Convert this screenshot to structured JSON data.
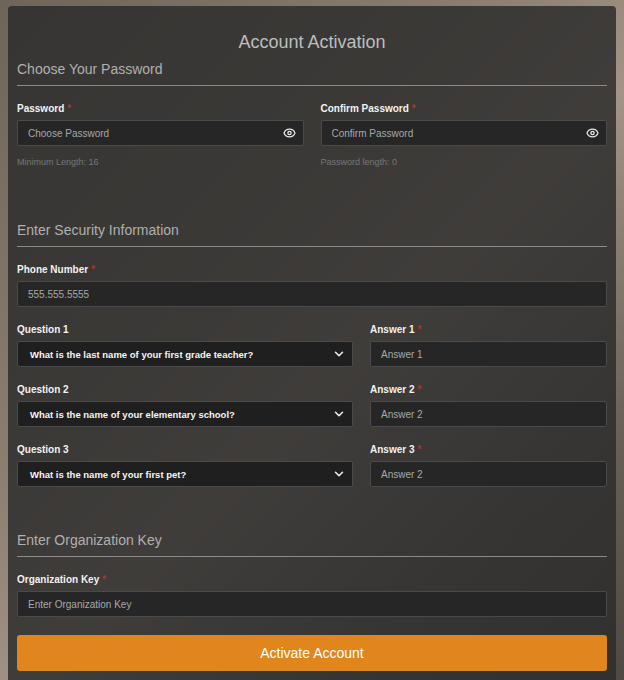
{
  "title": "Account Activation",
  "required_mark": "*",
  "password_section": {
    "heading": "Choose Your Password",
    "fields": [
      {
        "label": "Password",
        "placeholder": "Choose Password",
        "hint": "Minimum Length: 16",
        "required": true
      },
      {
        "label": "Confirm Password",
        "placeholder": "Confirm Password",
        "hint": "Password length: 0",
        "required": true
      }
    ]
  },
  "security_section": {
    "heading": "Enter Security Information",
    "phone": {
      "label": "Phone Number",
      "placeholder": "555.555.5555",
      "required": true
    },
    "questions": [
      {
        "label": "Question 1",
        "value": "What is the last name of your first grade teacher?",
        "answer_label": "Answer 1",
        "answer_placeholder": "Answer 1",
        "required": true
      },
      {
        "label": "Question 2",
        "value": "What is the name of your elementary school?",
        "answer_label": "Answer 2",
        "answer_placeholder": "Answer 2",
        "required": true
      },
      {
        "label": "Question 3",
        "value": "What is the name of your first pet?",
        "answer_label": "Answer 3",
        "answer_placeholder": "Answer 2",
        "required": true
      }
    ]
  },
  "organization_section": {
    "heading": "Enter Organization Key",
    "field": {
      "label": "Organization Key",
      "placeholder": "Enter Organization Key",
      "required": true
    }
  },
  "button": "Activate Account"
}
